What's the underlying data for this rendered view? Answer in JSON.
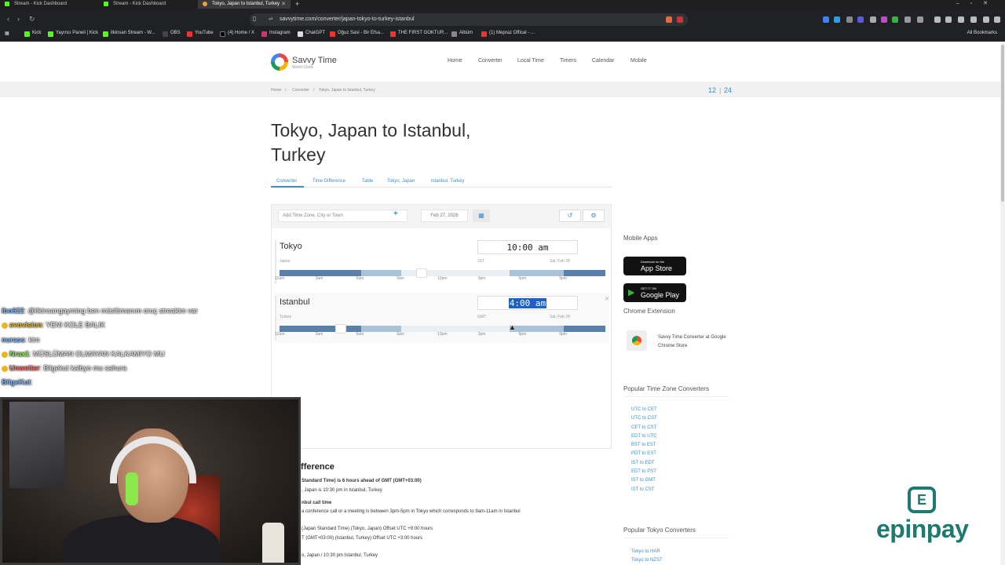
{
  "browser": {
    "tabs": [
      {
        "title": "Stream - Kick Dashboard"
      },
      {
        "title": "Stream - Kick Dashboard"
      },
      {
        "title": "Tokyo, Japan to Istanbul, Turkey"
      }
    ],
    "url": "savvytime.com/converter/japan-tokyo-to-turkey-istanbul",
    "bookmarks": [
      "Kick",
      "Yayıncı Paneli | Kick",
      "ilkinsan Stream - W...",
      "OBS",
      "YouTube",
      "(4) Home / X",
      "Instagram",
      "ChatGPT",
      "Oğuz Sasi - Bir Efsa...",
      "THE FIRST GOKTUR...",
      "Albüm",
      "(1) Mepraz Offical - ..."
    ],
    "all_bookmarks": "All Bookmarks"
  },
  "site": {
    "logo_title": "Savvy Time",
    "logo_sub": "World Clock",
    "nav": [
      "Home",
      "Converter",
      "Local Time",
      "Timers",
      "Calendar",
      "Mobile"
    ],
    "breadcrumb": [
      "Home",
      "Converter",
      "Tokyo, Japan to Istanbul, Turkey"
    ],
    "hour_12": "12",
    "hour_sep": "|",
    "hour_24": "24",
    "title": "Tokyo, Japan to Istanbul, Turkey",
    "subnav": [
      "Converter",
      "Time Difference",
      "Table",
      "Tokyo, Japan",
      "Istanbul, Turkey"
    ]
  },
  "converter": {
    "tz_placeholder": "Add Time Zone, City or Town",
    "date": "Feb 27, 2026",
    "hour_labels": [
      "12am",
      "3am",
      "6am",
      "9am",
      "12pm",
      "3pm",
      "6pm",
      "9pm"
    ],
    "rows": [
      {
        "city": "Tokyo",
        "country": "Japan",
        "time": "10:00 am",
        "abbr": "JST",
        "day": "Sat, Feb 28",
        "slider_hour": 10
      },
      {
        "city": "Istanbul",
        "country": "Turkey",
        "time": "4:00 am",
        "abbr": "GMT",
        "day": "Sat, Feb 28",
        "slider_hour": 4
      }
    ]
  },
  "sidebar": {
    "mobile_apps": "Mobile Apps",
    "app_store_small": "Download on the",
    "app_store": "App Store",
    "google_small": "GET IT ON",
    "google": "Google Play",
    "chrome_ext": "Chrome Extension",
    "chrome_text": "Savvy Time Converter at Google Chrome Store",
    "popular_tz": "Popular Time Zone Converters",
    "tz_links": [
      "UTC to CET",
      "UTC to CST",
      "CET to CST",
      "EDT to UTC",
      "BST to EST",
      "PDT to EST",
      "IST to EDT",
      "EDT to PST",
      "IST to GMT",
      "IST to CST"
    ],
    "popular_tokyo": "Popular Tokyo Converters",
    "tokyo_links": [
      "Tokyo to HAR",
      "Tokyo to NZST"
    ]
  },
  "difference": {
    "heading": "ifference",
    "lines": [
      "Standard Time) is 6 hours ahead of GMT (GMT+03:00)",
      ", Japan is 10:30 pm in Istanbul, Turkey",
      "nbul call time",
      "a conference call or a meeting is between 3pm-5pm in Tokyo which corresponds to 9am-11am in Istanbul",
      "(Japan Standard Time) (Tokyo, Japan)  Offset UTC +9:00 hours",
      "T (GMT+03:00) (Istanbul, Turkey)  Offset UTC +3:00 hours",
      "o, Japan / 10:30 pm Istanbul, Turkey"
    ]
  },
  "chat": [
    {
      "user": "ibo622",
      "msg": ": @ilkinsangayming ben müslümanım oruç streakim var",
      "color": "#7fb6ff"
    },
    {
      "user": "evovision",
      "msg": ": YENI KOLE BALIK",
      "color": "#e8b623"
    },
    {
      "user": "nurass",
      "msg": ": kim",
      "color": "#7fb6ff"
    },
    {
      "user": "Nrax1",
      "msg": ": MÜSLÜMAN OLMAYAN KALKAMIYO MU",
      "color": "#8ae84a"
    },
    {
      "user": "Unwetter",
      "msg": ": Bilgekut kalbyo mu sahura",
      "color": "#ff6b6b"
    },
    {
      "user": "BilgeKut",
      "msg": ":",
      "color": "#7fb6ff"
    }
  ],
  "overlay_brand": "epinpay"
}
